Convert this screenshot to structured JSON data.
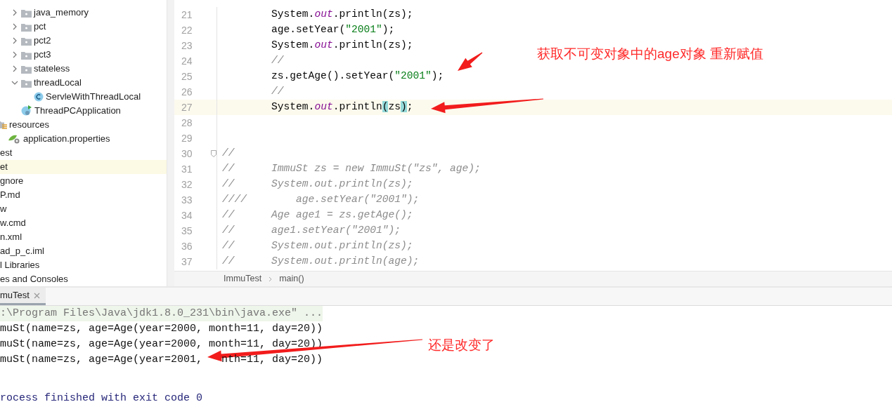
{
  "project_tree": {
    "package_items": [
      {
        "label": "java_memory",
        "kind": "package",
        "expanded": false,
        "selected": false
      },
      {
        "label": "pct",
        "kind": "package",
        "expanded": false,
        "selected": false
      },
      {
        "label": "pct2",
        "kind": "package",
        "expanded": false,
        "selected": false
      },
      {
        "label": "pct3",
        "kind": "package",
        "expanded": false,
        "selected": false
      },
      {
        "label": "stateless",
        "kind": "package",
        "expanded": false,
        "selected": false
      },
      {
        "label": "threadLocal",
        "kind": "package",
        "expanded": true,
        "selected": false,
        "children": [
          {
            "label": "ServleWithThreadLocal",
            "kind": "class",
            "selected": false
          }
        ]
      },
      {
        "label": "ThreadPCApplication",
        "kind": "app",
        "selected": false
      }
    ],
    "items": [
      {
        "label": "resources",
        "kind": "resources",
        "selected": false,
        "children": [
          {
            "label": "application.properties",
            "kind": "properties",
            "selected": false
          }
        ]
      },
      {
        "label": "est",
        "kind": "file",
        "selected": false
      },
      {
        "label": "et",
        "kind": "file",
        "selected": true
      },
      {
        "label": "gnore",
        "kind": "file",
        "selected": false
      },
      {
        "label": "P.md",
        "kind": "file",
        "selected": false
      },
      {
        "label": "w",
        "kind": "file",
        "selected": false
      },
      {
        "label": "w.cmd",
        "kind": "file",
        "selected": false
      },
      {
        "label": "n.xml",
        "kind": "file",
        "selected": false
      },
      {
        "label": "ad_p_c.iml",
        "kind": "file",
        "selected": false
      },
      {
        "label": "l Libraries",
        "kind": "file",
        "selected": false
      },
      {
        "label": "es and Consoles",
        "kind": "file",
        "selected": false
      }
    ]
  },
  "editor": {
    "lines": [
      {
        "number": "21",
        "highlighted": false,
        "fold": false,
        "segments": [
          {
            "kind": "code",
            "text": "        System."
          },
          {
            "kind": "field",
            "text": "out"
          },
          {
            "kind": "code",
            "text": ".println(zs);"
          }
        ]
      },
      {
        "number": "22",
        "highlighted": false,
        "fold": false,
        "segments": [
          {
            "kind": "code",
            "text": "        age.setYear("
          },
          {
            "kind": "string",
            "text": "\"2001\""
          },
          {
            "kind": "code",
            "text": ");"
          }
        ]
      },
      {
        "number": "23",
        "highlighted": false,
        "fold": false,
        "segments": [
          {
            "kind": "code",
            "text": "        System."
          },
          {
            "kind": "field",
            "text": "out"
          },
          {
            "kind": "code",
            "text": ".println(zs);"
          }
        ]
      },
      {
        "number": "24",
        "highlighted": false,
        "fold": false,
        "segments": [
          {
            "kind": "comment",
            "text": "        //"
          }
        ]
      },
      {
        "number": "25",
        "highlighted": false,
        "fold": false,
        "segments": [
          {
            "kind": "code",
            "text": "        zs.getAge().setYear("
          },
          {
            "kind": "string",
            "text": "\"2001\""
          },
          {
            "kind": "code",
            "text": ");"
          }
        ]
      },
      {
        "number": "26",
        "highlighted": false,
        "fold": false,
        "segments": [
          {
            "kind": "comment",
            "text": "        //"
          }
        ]
      },
      {
        "number": "27",
        "highlighted": true,
        "fold": false,
        "segments": [
          {
            "kind": "code",
            "text": "        System."
          },
          {
            "kind": "field",
            "text": "out"
          },
          {
            "kind": "code",
            "text": ".println"
          },
          {
            "kind": "brace",
            "text": "("
          },
          {
            "kind": "code",
            "text": "zs"
          },
          {
            "kind": "brace",
            "text": ")"
          },
          {
            "kind": "code",
            "text": ";"
          }
        ]
      },
      {
        "number": "28",
        "highlighted": false,
        "fold": false
      },
      {
        "number": "29",
        "highlighted": false,
        "fold": false
      },
      {
        "number": "30",
        "highlighted": false,
        "fold": true,
        "segments": [
          {
            "kind": "comment",
            "text": "//"
          }
        ]
      },
      {
        "number": "31",
        "highlighted": false,
        "fold": false,
        "segments": [
          {
            "kind": "comment",
            "text": "//      ImmuSt zs = new ImmuSt(\"zs\", age);"
          }
        ]
      },
      {
        "number": "32",
        "highlighted": false,
        "fold": false,
        "segments": [
          {
            "kind": "comment",
            "text": "//      System.out.println(zs);"
          }
        ]
      },
      {
        "number": "33",
        "highlighted": false,
        "fold": false,
        "segments": [
          {
            "kind": "comment",
            "text": "////        age.setYear(\"2001\");"
          }
        ]
      },
      {
        "number": "34",
        "highlighted": false,
        "fold": false,
        "segments": [
          {
            "kind": "comment",
            "text": "//      Age age1 = zs.getAge();"
          }
        ]
      },
      {
        "number": "35",
        "highlighted": false,
        "fold": false,
        "segments": [
          {
            "kind": "comment",
            "text": "//      age1.setYear(\"2001\");"
          }
        ]
      },
      {
        "number": "36",
        "highlighted": false,
        "fold": false,
        "segments": [
          {
            "kind": "comment",
            "text": "//      System.out.println(zs);"
          }
        ]
      },
      {
        "number": "37",
        "highlighted": false,
        "fold": false,
        "segments": [
          {
            "kind": "comment",
            "text": "//      System.out.println(age);"
          }
        ]
      }
    ],
    "breadcrumb": [
      "ImmuTest",
      "main()"
    ]
  },
  "run_panel": {
    "tabs": [
      {
        "label": "muTest",
        "selected": true
      }
    ],
    "output": [
      {
        "kind": "command",
        "text": ":\\Program Files\\Java\\jdk1.8.0_231\\bin\\java.exe\" ..."
      },
      {
        "kind": "stdout",
        "text": "muSt(name=zs, age=Age(year=2000, month=11, day=20))"
      },
      {
        "kind": "stdout",
        "text": "muSt(name=zs, age=Age(year=2000, month=11, day=20))"
      },
      {
        "kind": "stdout",
        "parts": [
          "muSt(name=zs, age=Age(year=2001,",
          "nth=11, day=20))"
        ]
      },
      {
        "kind": "exit",
        "text": "rocess finished with exit code 0"
      }
    ]
  },
  "annotations": [
    {
      "text": "获取不可变对象中的age对象 重新赋值"
    },
    {
      "text": "还是改变了"
    }
  ]
}
